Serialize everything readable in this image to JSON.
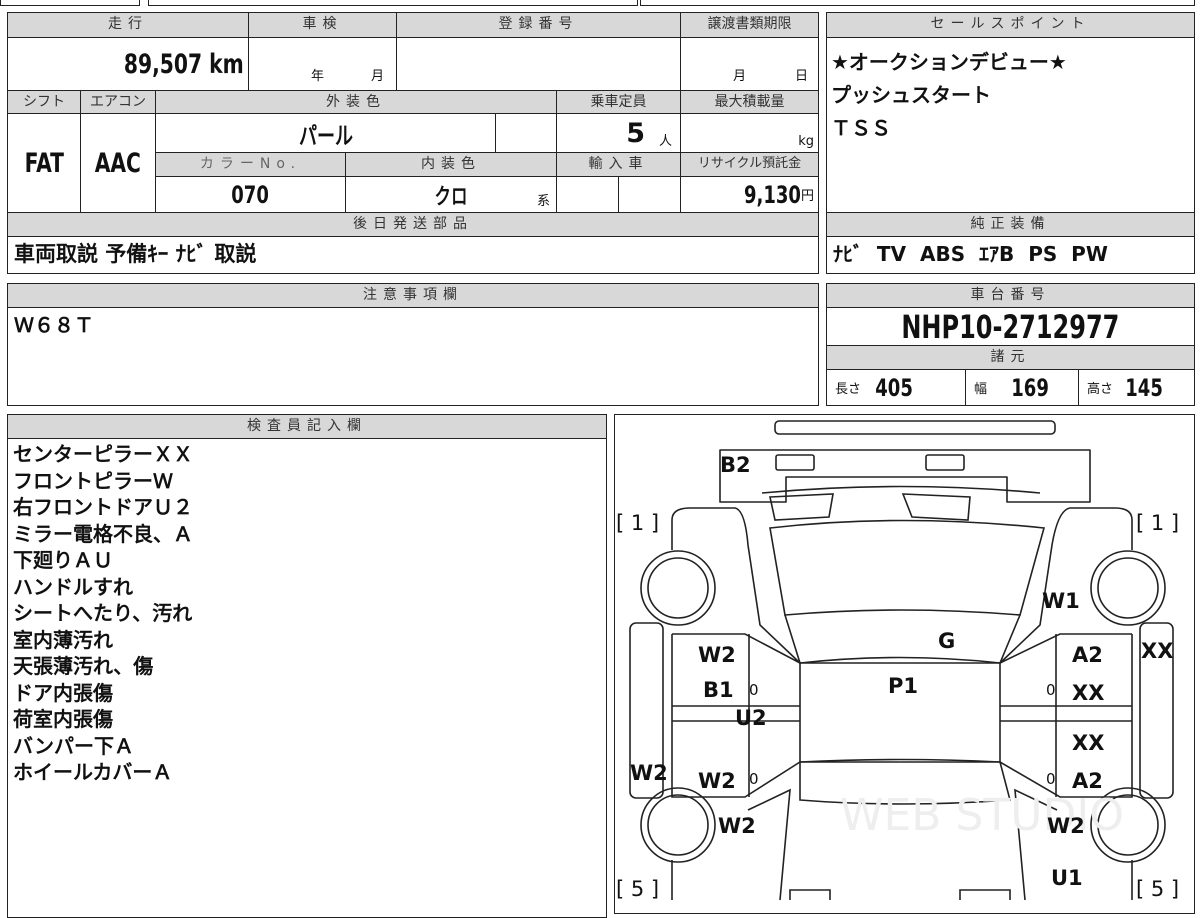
{
  "mileage": {
    "label": "走行",
    "value": "89,507",
    "unit": "km"
  },
  "shaken": {
    "label": "車検",
    "year": "年",
    "month": "月"
  },
  "registration": {
    "label": "登録番号",
    "value": ""
  },
  "transfer_deadline": {
    "label": "譲渡書類期限",
    "month": "月",
    "day": "日"
  },
  "shift": {
    "label": "シフト",
    "value": "FAT"
  },
  "aircon": {
    "label": "エアコン",
    "value": "AAC"
  },
  "exterior_color": {
    "label": "外装色",
    "value": "パール"
  },
  "capacity": {
    "label": "乗車定員",
    "value": "5",
    "unit": "人"
  },
  "max_load": {
    "label": "最大積載量",
    "unit": "kg"
  },
  "color_no": {
    "label": "カラーNo.",
    "value": "070"
  },
  "interior_color": {
    "label": "内装色",
    "value": "クロ",
    "suffix": "系"
  },
  "import": {
    "label": "輸入車"
  },
  "recycle": {
    "label": "リサイクル預託金",
    "value": "9,130",
    "unit": "円"
  },
  "later_parts": {
    "label": "後日発送部品",
    "value": "車両取説 予備ｷｰ ﾅﾋﾞ 取説"
  },
  "sales_points": {
    "label": "セールスポイント",
    "lines": [
      "★オークションデビュー★",
      "プッシュスタート",
      "ＴＳＳ"
    ]
  },
  "equipment": {
    "label": "純正装備",
    "value": "ﾅﾋﾞ  TV  ABS  ｴｱB  PS  PW"
  },
  "notes": {
    "label": "注意事項欄",
    "value": "Ｗ６８Ｔ"
  },
  "chassis": {
    "label": "車台番号",
    "value": "NHP10-2712977"
  },
  "specs": {
    "label": "諸元",
    "length_label": "長さ",
    "length": "405",
    "width_label": "幅",
    "width": "169",
    "height_label": "高さ",
    "height": "145"
  },
  "inspector": {
    "label": "検査員記入欄",
    "lines": [
      "センターピラーＸＸ",
      "フロントピラーＷ",
      "右フロントドアＵ２",
      "ミラー電格不良、Ａ",
      "下廻りＡＵ",
      "ハンドルすれ",
      "シートへたり、汚れ",
      "室内薄汚れ",
      "天張薄汚れ、傷",
      "ドア内張傷",
      "荷室内張傷",
      "バンパー下Ａ",
      "ホイールカバーＡ"
    ]
  },
  "diagram": {
    "marks": [
      "B2",
      "[ 1 ]",
      "[ 1 ]",
      "W1",
      "G",
      "W2",
      "A2",
      "XX",
      "B1",
      "0",
      "P1",
      "0",
      "XX",
      "U2",
      "XX",
      "W2",
      "W2",
      "0",
      "0",
      "A2",
      "W2",
      "W2",
      "U1",
      "[ 5 ]",
      "[ 5 ]"
    ],
    "watermark": "WEB STUDIO"
  }
}
